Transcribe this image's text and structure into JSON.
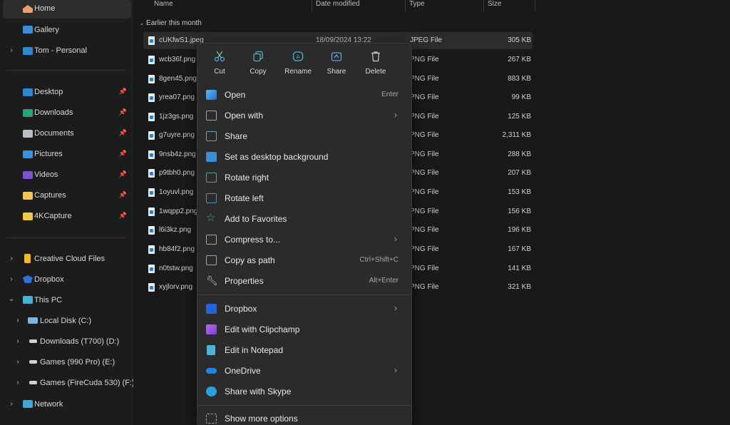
{
  "sidebar": {
    "items": [
      {
        "label": "Home",
        "icon": "home-icon"
      },
      {
        "label": "Gallery",
        "icon": "gallery-icon"
      },
      {
        "label": "Tom - Personal",
        "icon": "onedrive-folder-icon"
      },
      {
        "label": "Desktop",
        "icon": "desktop-icon"
      },
      {
        "label": "Downloads",
        "icon": "downloads-icon"
      },
      {
        "label": "Documents",
        "icon": "documents-icon"
      },
      {
        "label": "Pictures",
        "icon": "pictures-icon"
      },
      {
        "label": "Videos",
        "icon": "videos-icon"
      },
      {
        "label": "Captures",
        "icon": "folder-icon"
      },
      {
        "label": "4KCapture",
        "icon": "folder-icon"
      },
      {
        "label": "Creative Cloud Files",
        "icon": "creative-cloud-icon"
      },
      {
        "label": "Dropbox",
        "icon": "dropbox-icon"
      },
      {
        "label": "This PC",
        "icon": "pc-icon"
      },
      {
        "label": "Local Disk (C:)",
        "icon": "drive-icon"
      },
      {
        "label": "Downloads (T700) (D:)",
        "icon": "drive-icon"
      },
      {
        "label": "Games (990 Pro) (E:)",
        "icon": "drive-icon"
      },
      {
        "label": "Games (FireCuda 530) (F:)",
        "icon": "drive-icon"
      },
      {
        "label": "Network",
        "icon": "network-icon"
      }
    ],
    "pin_glyph": "📌"
  },
  "columns": {
    "name": "Name",
    "date": "Date modified",
    "type": "Type",
    "size": "Size"
  },
  "group_label": "Earlier this month",
  "files": [
    {
      "name": "cUKfwS1.jpeg",
      "date": "18/09/2024 13:22",
      "type": "JPEG File",
      "size": "305 KB"
    },
    {
      "name": "wcb36f.png",
      "type": "PNG File",
      "size": "267 KB"
    },
    {
      "name": "8gen45.png",
      "type": "PNG File",
      "size": "883 KB"
    },
    {
      "name": "yrea07.png",
      "type": "PNG File",
      "size": "99 KB"
    },
    {
      "name": "1jz3gs.png",
      "type": "PNG File",
      "size": "125 KB"
    },
    {
      "name": "g7uyre.png",
      "type": "PNG File",
      "size": "2,311 KB"
    },
    {
      "name": "9nsb4z.png",
      "type": "PNG File",
      "size": "288 KB"
    },
    {
      "name": "p9tbh0.png",
      "type": "PNG File",
      "size": "207 KB"
    },
    {
      "name": "1oyuvl.png",
      "type": "PNG File",
      "size": "153 KB"
    },
    {
      "name": "1wqpp2.png",
      "type": "PNG File",
      "size": "156 KB"
    },
    {
      "name": "l6i3kz.png",
      "type": "PNG File",
      "size": "196 KB"
    },
    {
      "name": "hb84f2.png",
      "type": "PNG File",
      "size": "167 KB"
    },
    {
      "name": "n0tstw.png",
      "type": "PNG File",
      "size": "141 KB"
    },
    {
      "name": "xyjlorv.png",
      "type": "PNG File",
      "size": "321 KB"
    }
  ],
  "context_menu": {
    "quick_actions": [
      {
        "label": "Cut",
        "icon": "cut-icon"
      },
      {
        "label": "Copy",
        "icon": "copy-icon"
      },
      {
        "label": "Rename",
        "icon": "rename-icon"
      },
      {
        "label": "Share",
        "icon": "share-icon"
      },
      {
        "label": "Delete",
        "icon": "delete-icon"
      }
    ],
    "items": [
      {
        "label": "Open",
        "shortcut": "Enter",
        "icon": "photos-icon"
      },
      {
        "label": "Open with",
        "submenu": true,
        "icon": "open-with-icon"
      },
      {
        "label": "Share",
        "icon": "share-icon"
      },
      {
        "label": "Set as desktop background",
        "icon": "desktop-background-icon"
      },
      {
        "label": "Rotate right",
        "icon": "rotate-right-icon"
      },
      {
        "label": "Rotate left",
        "icon": "rotate-left-icon"
      },
      {
        "label": "Add to Favorites",
        "icon": "star-icon"
      },
      {
        "label": "Compress to...",
        "submenu": true,
        "icon": "compress-icon"
      },
      {
        "label": "Copy as path",
        "shortcut": "Ctrl+Shift+C",
        "icon": "copy-path-icon"
      },
      {
        "label": "Properties",
        "shortcut": "Alt+Enter",
        "icon": "wrench-icon"
      }
    ],
    "app_items": [
      {
        "label": "Dropbox",
        "submenu": true,
        "icon": "dropbox-icon"
      },
      {
        "label": "Edit with Clipchamp",
        "icon": "clipchamp-icon"
      },
      {
        "label": "Edit in Notepad",
        "icon": "notepad-icon"
      },
      {
        "label": "OneDrive",
        "submenu": true,
        "icon": "onedrive-icon"
      },
      {
        "label": "Share with Skype",
        "icon": "skype-icon"
      }
    ],
    "more": {
      "label": "Show more options",
      "icon": "more-options-icon"
    },
    "submenu_glyph": "›"
  }
}
